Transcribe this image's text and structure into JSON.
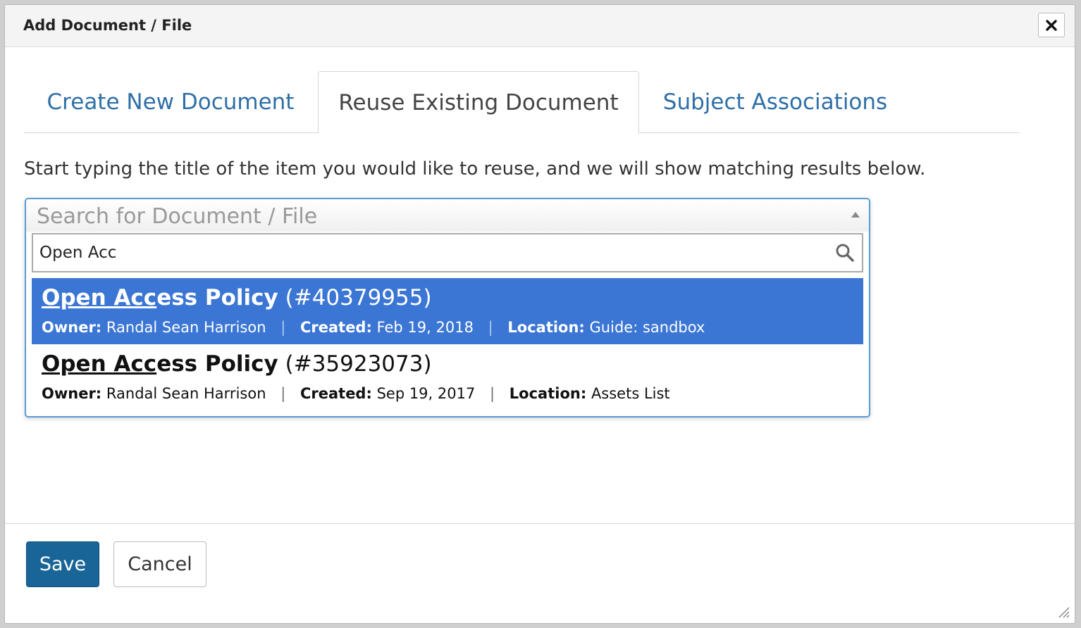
{
  "dialog": {
    "title": "Add Document / File",
    "close_icon": "close-icon"
  },
  "tabs": [
    {
      "label": "Create New Document",
      "active": false
    },
    {
      "label": "Reuse Existing Document",
      "active": true
    },
    {
      "label": "Subject Associations",
      "active": false
    }
  ],
  "instruction": "Start typing the title of the item you would like to reuse, and we will show matching results below.",
  "select": {
    "placeholder": "Search for Document / File",
    "search_value": "Open Acc",
    "search_icon": "search-icon"
  },
  "results": [
    {
      "title_match": "Open Acc",
      "title_rest": "ess Policy",
      "id": "(#40379955)",
      "owner_label": "Owner:",
      "owner": "Randal Sean Harrison",
      "created_label": "Created:",
      "created": "Feb 19, 2018",
      "location_label": "Location:",
      "location": "Guide: sandbox",
      "highlighted": true
    },
    {
      "title_match": "Open Acc",
      "title_rest": "ess Policy",
      "id": "(#35923073)",
      "owner_label": "Owner:",
      "owner": "Randal Sean Harrison",
      "created_label": "Created:",
      "created": "Sep 19, 2017",
      "location_label": "Location:",
      "location": "Assets List",
      "highlighted": false
    }
  ],
  "separator": "|",
  "buttons": {
    "save": "Save",
    "cancel": "Cancel"
  },
  "colors": {
    "accent": "#2f6fa6",
    "highlight": "#3b76d4",
    "primary_button": "#1a6597"
  }
}
